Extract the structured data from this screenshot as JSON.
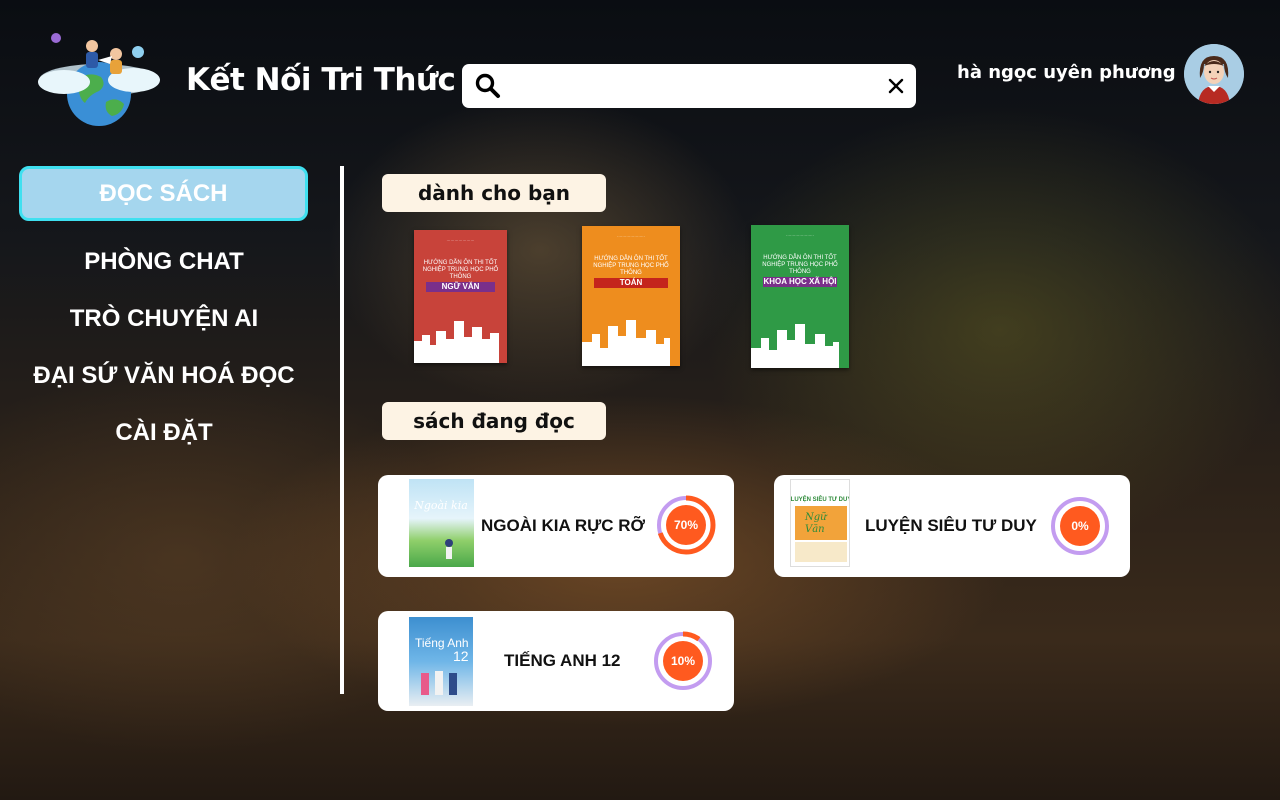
{
  "app": {
    "title": "Kết Nối Tri Thức"
  },
  "search": {
    "value": "",
    "placeholder": ""
  },
  "user": {
    "name": "hà ngọc uyên phương"
  },
  "sidebar": {
    "items": [
      {
        "label": "ĐỌC SÁCH",
        "active": true
      },
      {
        "label": "PHÒNG CHAT",
        "active": false
      },
      {
        "label": "TRÒ CHUYỆN AI",
        "active": false
      },
      {
        "label": "ĐẠI SỨ VĂN HOÁ ĐỌC",
        "active": false
      },
      {
        "label": "CÀI ĐẶT",
        "active": false
      }
    ]
  },
  "for_you": {
    "heading": "dành cho bạn",
    "books": [
      {
        "header": "HƯỚNG DẪN ÔN THI TỐT NGHIỆP TRUNG HỌC PHỔ THÔNG",
        "subject": "NGỮ VĂN",
        "color": "#c8433a"
      },
      {
        "header": "HƯỚNG DẪN ÔN THI TỐT NGHIỆP TRUNG HỌC PHỔ THÔNG",
        "subject": "TOÁN",
        "color": "#ee8d1e"
      },
      {
        "header": "HƯỚNG DẪN ÔN THI TỐT NGHIỆP TRUNG HỌC PHỔ THÔNG",
        "subject": "KHOA HỌC XÃ HỘI",
        "color": "#2f9a46"
      }
    ]
  },
  "reading": {
    "heading": "sách đang đọc",
    "books": [
      {
        "title": "NGOÀI KIA RỰC RỠ",
        "progress": 70,
        "progress_label": "70%"
      },
      {
        "title": "LUYỆN SIÊU TƯ DUY",
        "progress": 0,
        "progress_label": "0%"
      },
      {
        "title": "TIẾNG ANH 12",
        "progress": 10,
        "progress_label": "10%"
      }
    ]
  },
  "colors": {
    "accent_orange": "#ff5a1f",
    "ring_track": "#c39cf0",
    "active_nav_bg": "#a5d6ee",
    "active_nav_border": "#3fe0f0",
    "tag_bg": "#fdf3e4"
  }
}
